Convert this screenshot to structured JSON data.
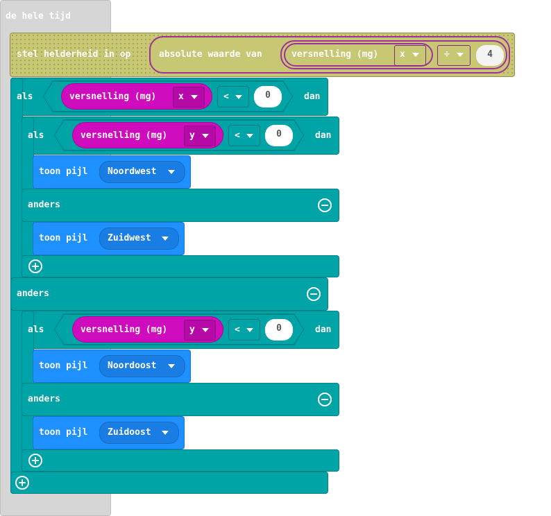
{
  "forever": {
    "label": "de hele tijd"
  },
  "brightness": {
    "label": "stel helderheid in op",
    "abs_label": "absolute waarde van",
    "accel_label": "versnelling (mg)",
    "axis": "x",
    "operator": "÷",
    "divisor": "4"
  },
  "outer_if": {
    "if_label": "als",
    "then_label": "dan",
    "else_label": "anders",
    "sensor_label": "versnelling (mg)",
    "axis": "x",
    "operator": "<",
    "value": "0"
  },
  "inner_if_1": {
    "if_label": "als",
    "then_label": "dan",
    "else_label": "anders",
    "sensor_label": "versnelling (mg)",
    "axis": "y",
    "operator": "<",
    "value": "0",
    "then_action": {
      "label": "toon pijl",
      "arrow": "Noordwest"
    },
    "else_action": {
      "label": "toon pijl",
      "arrow": "Zuidwest"
    }
  },
  "inner_if_2": {
    "if_label": "als",
    "then_label": "dan",
    "else_label": "anders",
    "sensor_label": "versnelling (mg)",
    "axis": "y",
    "operator": "<",
    "value": "0",
    "then_action": {
      "label": "toon pijl",
      "arrow": "Noordoost"
    },
    "else_action": {
      "label": "toon pijl",
      "arrow": "Zuidoost"
    }
  },
  "colors": {
    "loops": "#d6d6d6",
    "led": "#c8c774",
    "logic": "#00a4a6",
    "input": "#cf0bbe",
    "basic": "#1e90ff"
  }
}
